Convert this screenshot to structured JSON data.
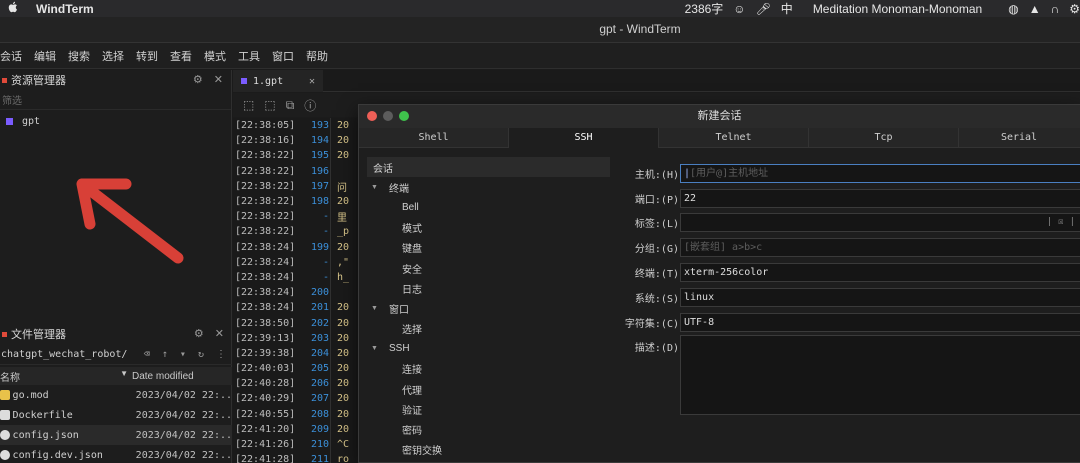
{
  "mac_menubar": {
    "app_name": "WindTerm",
    "word_count": "2386字",
    "input_method": "中",
    "now_playing": "Meditation Monoman-Monoman"
  },
  "window": {
    "title": "gpt - WindTerm"
  },
  "menu": [
    "会话",
    "编辑",
    "搜索",
    "选择",
    "转到",
    "查看",
    "模式",
    "工具",
    "窗口",
    "帮助"
  ],
  "resource_manager": {
    "title": "资源管理器",
    "filter_placeholder": "筛选",
    "items": [
      "gpt"
    ]
  },
  "file_manager": {
    "title": "文件管理器",
    "path": "chatgpt_wechat_robot/",
    "columns": {
      "name": "名称",
      "date": "Date modified"
    },
    "files": [
      {
        "name": "go.mod",
        "date": "2023/04/02 22:..",
        "icon_color": "#e8c24a"
      },
      {
        "name": "Dockerfile",
        "date": "2023/04/02 22:..",
        "icon_color": "#dcdcdc"
      },
      {
        "name": "config.json",
        "date": "2023/04/02 22:..",
        "icon_color": "#dcdcdc"
      },
      {
        "name": "config.dev.json",
        "date": "2023/04/02 22:..",
        "icon_color": "#dcdcdc"
      }
    ]
  },
  "terminal": {
    "tab_label": "1.gpt",
    "lines": [
      {
        "ts": "[22:38:05]",
        "ln": "193",
        "tx": "20"
      },
      {
        "ts": "[22:38:16]",
        "ln": "194",
        "tx": "20"
      },
      {
        "ts": "[22:38:22]",
        "ln": "195",
        "tx": "20"
      },
      {
        "ts": "[22:38:22]",
        "ln": "196",
        "tx": ""
      },
      {
        "ts": "[22:38:22]",
        "ln": "197",
        "tx": "问"
      },
      {
        "ts": "[22:38:22]",
        "ln": "198",
        "tx": "20"
      },
      {
        "ts": "[22:38:22]",
        "ln": "-",
        "tx": "里"
      },
      {
        "ts": "[22:38:22]",
        "ln": "-",
        "tx": "_p"
      },
      {
        "ts": "[22:38:24]",
        "ln": "199",
        "tx": "20"
      },
      {
        "ts": "[22:38:24]",
        "ln": "-",
        "tx": ",\""
      },
      {
        "ts": "[22:38:24]",
        "ln": "-",
        "tx": "h_"
      },
      {
        "ts": "[22:38:24]",
        "ln": "200",
        "tx": ""
      },
      {
        "ts": "[22:38:24]",
        "ln": "201",
        "tx": "20"
      },
      {
        "ts": "[22:38:50]",
        "ln": "202",
        "tx": "20"
      },
      {
        "ts": "[22:39:13]",
        "ln": "203",
        "tx": "20"
      },
      {
        "ts": "[22:39:38]",
        "ln": "204",
        "tx": "20"
      },
      {
        "ts": "[22:40:03]",
        "ln": "205",
        "tx": "20"
      },
      {
        "ts": "[22:40:28]",
        "ln": "206",
        "tx": "20"
      },
      {
        "ts": "[22:40:29]",
        "ln": "207",
        "tx": "20"
      },
      {
        "ts": "[22:40:55]",
        "ln": "208",
        "tx": "20"
      },
      {
        "ts": "[22:41:20]",
        "ln": "209",
        "tx": "20"
      },
      {
        "ts": "[22:41:26]",
        "ln": "210",
        "tx": "^C"
      },
      {
        "ts": "[22:41:28]",
        "ln": "211",
        "tx": "ro"
      }
    ]
  },
  "dialog": {
    "title": "新建会话",
    "tabs": [
      "Shell",
      "SSH",
      "Telnet",
      "Tcp",
      "Serial"
    ],
    "active_tab": "SSH",
    "nav": [
      {
        "label": "会话",
        "kind": "top"
      },
      {
        "label": "终端",
        "kind": "group"
      },
      {
        "label": "Bell",
        "kind": "child"
      },
      {
        "label": "模式",
        "kind": "child"
      },
      {
        "label": "键盘",
        "kind": "child"
      },
      {
        "label": "安全",
        "kind": "child"
      },
      {
        "label": "日志",
        "kind": "child"
      },
      {
        "label": "窗口",
        "kind": "group"
      },
      {
        "label": "选择",
        "kind": "child"
      },
      {
        "label": "SSH",
        "kind": "group"
      },
      {
        "label": "连接",
        "kind": "child"
      },
      {
        "label": "代理",
        "kind": "child"
      },
      {
        "label": "验证",
        "kind": "child"
      },
      {
        "label": "密码",
        "kind": "child"
      },
      {
        "label": "密钥交换",
        "kind": "child"
      }
    ],
    "form": {
      "host": {
        "label": "主机:(H)",
        "placeholder": "[用户@]主机地址"
      },
      "port": {
        "label": "端口:(P)",
        "value": "22"
      },
      "tag": {
        "label": "标签:(L)",
        "value": ""
      },
      "group": {
        "label": "分组:(G)",
        "placeholder": "[嵌套组] a>b>c"
      },
      "terminal": {
        "label": "终端:(T)",
        "value": "xterm-256color"
      },
      "system": {
        "label": "系统:(S)",
        "value": "linux"
      },
      "charset": {
        "label": "字符集:(C)",
        "value": "UTF-8"
      },
      "description": {
        "label": "描述:(D)",
        "value": ""
      }
    }
  }
}
